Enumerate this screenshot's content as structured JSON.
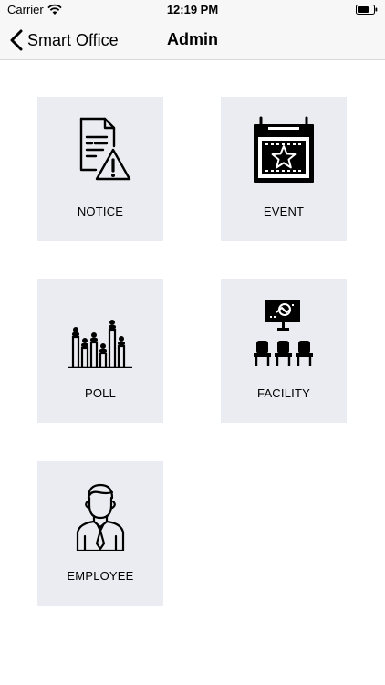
{
  "status_bar": {
    "carrier": "Carrier",
    "time": "12:19 PM"
  },
  "nav": {
    "back_label": "Smart Office",
    "title": "Admin"
  },
  "tiles": [
    {
      "label": "NOTICE",
      "icon": "notice-document-warning-icon"
    },
    {
      "label": "EVENT",
      "icon": "event-calendar-star-icon"
    },
    {
      "label": "POLL",
      "icon": "poll-bar-chart-people-icon"
    },
    {
      "label": "FACILITY",
      "icon": "facility-chairs-screen-icon"
    },
    {
      "label": "EMPLOYEE",
      "icon": "employee-person-icon"
    }
  ],
  "colors": {
    "tile_background": "#ebecf1",
    "bar_background": "#f7f7f7"
  }
}
